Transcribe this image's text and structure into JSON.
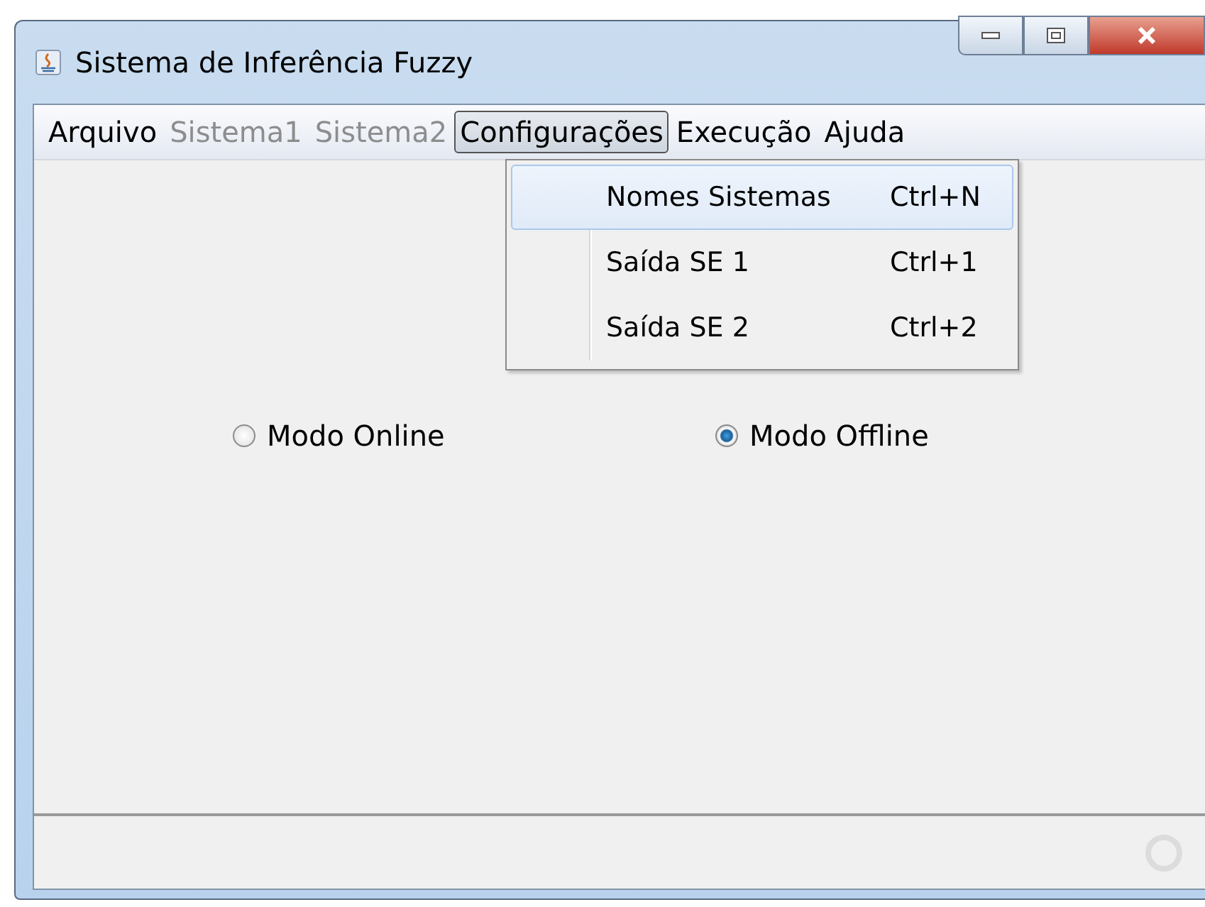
{
  "window": {
    "title": "Sistema de Inferência Fuzzy"
  },
  "menu_bar": [
    {
      "label": "Arquivo",
      "disabled": false,
      "selected": false
    },
    {
      "label": "Sistema1",
      "disabled": true,
      "selected": false
    },
    {
      "label": "Sistema2",
      "disabled": true,
      "selected": false
    },
    {
      "label": "Configurações",
      "disabled": false,
      "selected": true
    },
    {
      "label": "Execução",
      "disabled": false,
      "selected": false
    },
    {
      "label": "Ajuda",
      "disabled": false,
      "selected": false
    }
  ],
  "dropdown": {
    "items": [
      {
        "label": "Nomes Sistemas",
        "shortcut": "Ctrl+N",
        "selected": true
      },
      {
        "label": "Saída SE 1",
        "shortcut": "Ctrl+1",
        "selected": false
      },
      {
        "label": "Saída SE 2",
        "shortcut": "Ctrl+2",
        "selected": false
      }
    ]
  },
  "mode_options": [
    {
      "label": "Modo Online",
      "selected": false
    },
    {
      "label": "Modo Offline",
      "selected": true
    }
  ]
}
